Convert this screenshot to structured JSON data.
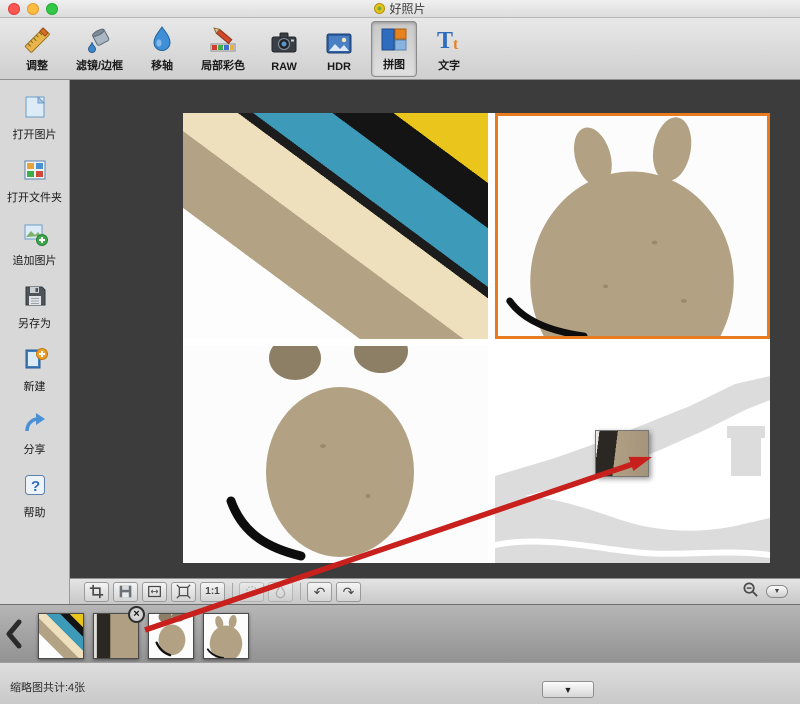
{
  "window": {
    "title": "好照片"
  },
  "toolbar": {
    "items": [
      {
        "label": "调整"
      },
      {
        "label": "滤镜/边框"
      },
      {
        "label": "移轴"
      },
      {
        "label": "局部彩色"
      },
      {
        "label": "RAW"
      },
      {
        "label": "HDR"
      },
      {
        "label": "拼图",
        "selected": true
      },
      {
        "label": "文字"
      }
    ]
  },
  "sidebar": {
    "items": [
      {
        "label": "打开图片"
      },
      {
        "label": "打开文件夹"
      },
      {
        "label": "追加图片"
      },
      {
        "label": "另存为"
      },
      {
        "label": "新建"
      },
      {
        "label": "分享"
      },
      {
        "label": "帮助"
      }
    ]
  },
  "canvas": {
    "collage_cells": [
      {
        "name": "paper-stripes"
      },
      {
        "name": "cardboard-rabbit",
        "selected": true
      },
      {
        "name": "cardboard-bear-face"
      },
      {
        "name": "great-wall",
        "drag_target": true
      }
    ]
  },
  "canvas_toolbar": {
    "actual_size_label": "1:1"
  },
  "thumbnail_bar": {
    "items": [
      {
        "name": "paper-stripes"
      },
      {
        "name": "cardboard",
        "closable": true
      },
      {
        "name": "bear-face"
      },
      {
        "name": "rabbit"
      }
    ]
  },
  "status_bar": {
    "summary": "缩略图共计:4张"
  },
  "glyphs": {
    "undo": "↶",
    "redo": "↷",
    "dropdown": "▼",
    "close": "×",
    "text_icon_T": "T",
    "text_icon_t": "t",
    "help": "?"
  },
  "colors": {
    "selection_orange": "#e87a1f",
    "arrow_red": "#c8201d",
    "canvas_bg": "#3c3c3c",
    "cardboard_tan": "#b2a183"
  }
}
